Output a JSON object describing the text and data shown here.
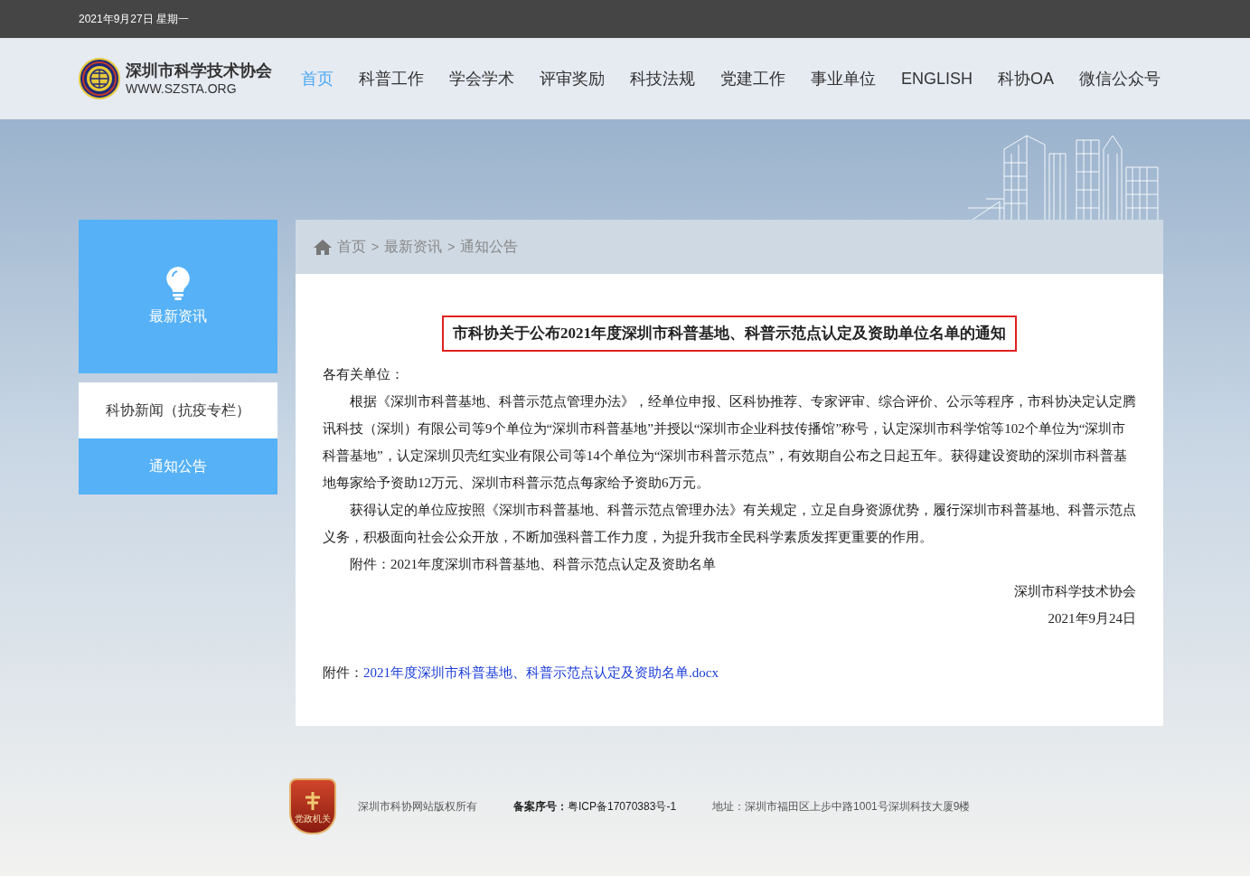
{
  "top_bar": {
    "date": "2021年9月27日 星期一"
  },
  "header": {
    "logo_title": "深圳市科学技术协会",
    "logo_subtitle": "WWW.SZSTA.ORG",
    "nav": [
      {
        "label": "首页",
        "selected": true
      },
      {
        "label": "科普工作",
        "selected": false
      },
      {
        "label": "学会学术",
        "selected": false
      },
      {
        "label": "评审奖励",
        "selected": false
      },
      {
        "label": "科技法规",
        "selected": false
      },
      {
        "label": "党建工作",
        "selected": false
      },
      {
        "label": "事业单位",
        "selected": false
      },
      {
        "label": "ENGLISH",
        "selected": false
      },
      {
        "label": "科协OA",
        "selected": false
      },
      {
        "label": "微信公众号",
        "selected": false
      }
    ]
  },
  "sidebar": {
    "title": "最新资讯",
    "items": [
      {
        "label": "科协新闻（抗疫专栏）",
        "selected": false
      },
      {
        "label": "通知公告",
        "selected": true
      }
    ]
  },
  "breadcrumb": {
    "separator": ">",
    "items": [
      "首页",
      "最新资讯",
      "通知公告"
    ]
  },
  "article": {
    "title": "市科协关于公布2021年度深圳市科普基地、科普示范点认定及资助单位名单的通知",
    "greeting": "各有关单位：",
    "paragraphs": [
      "根据《深圳市科普基地、科普示范点管理办法》，经单位申报、区科协推荐、专家评审、综合评价、公示等程序，市科协决定认定腾讯科技（深圳）有限公司等9个单位为“深圳市科普基地”并授以“深圳市企业科技传播馆”称号，认定深圳市科学馆等102个单位为“深圳市科普基地”，认定深圳贝壳红实业有限公司等14个单位为“深圳市科普示范点”，有效期自公布之日起五年。获得建设资助的深圳市科普基地每家给予资助12万元、深圳市科普示范点每家给予资助6万元。",
      "获得认定的单位应按照《深圳市科普基地、科普示范点管理办法》有关规定，立足自身资源优势，履行深圳市科普基地、科普示范点义务，积极面向社会公众开放，不断加强科普工作力度，为提升我市全民科学素质发挥更重要的作用。",
      "附件：2021年度深圳市科普基地、科普示范点认定及资助名单"
    ],
    "signature": "深圳市科学技术协会",
    "date": "2021年9月24日",
    "attachment_label": "附件：",
    "attachment_link": "2021年度深圳市科普基地、科普示范点认定及资助名单.docx"
  },
  "footer": {
    "badge_text": "党政机关",
    "copyright": "深圳市科协网站版权所有",
    "icp_label": "备案序号：",
    "icp": "粤ICP备17070383号-1",
    "address": "地址：深圳市福田区上步中路1001号深圳科技大厦9楼"
  }
}
